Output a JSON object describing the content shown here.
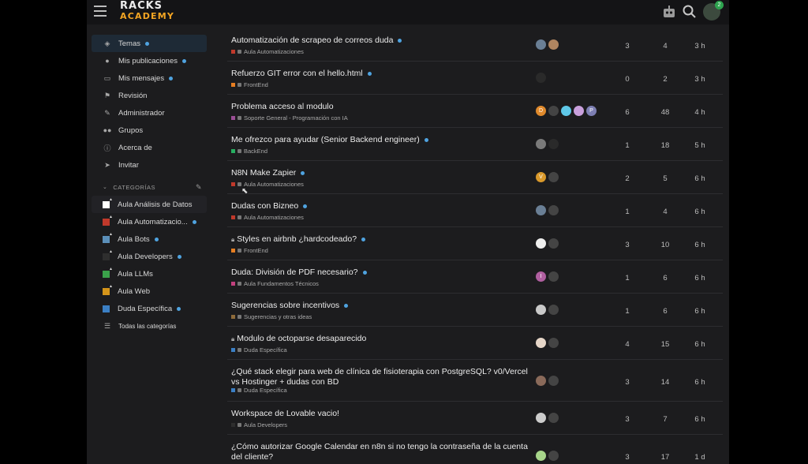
{
  "header": {
    "logo_top": "RACKS",
    "logo_bottom": "ACADEMY",
    "notification_count": "2"
  },
  "sidebar": {
    "items": [
      {
        "label": "Temas",
        "dot": true,
        "active": true
      },
      {
        "label": "Mis publicaciones",
        "dot": true
      },
      {
        "label": "Mis mensajes",
        "dot": true
      },
      {
        "label": "Revisión"
      },
      {
        "label": "Administrador"
      },
      {
        "label": "Grupos"
      },
      {
        "label": "Acerca de"
      },
      {
        "label": "Invitar"
      }
    ],
    "categories_heading": "CATEGORÍAS",
    "categories": [
      {
        "label": "Aula Análisis de Datos",
        "color": "#ffffff"
      },
      {
        "label": "Aula Automatizacio...",
        "color": "#c0392b",
        "dot": true
      },
      {
        "label": "Aula Bots",
        "color": "#5b8fb9",
        "dot": true
      },
      {
        "label": "Aula Developers",
        "color": "#2e2e2e",
        "dot": true
      },
      {
        "label": "Aula LLMs",
        "color": "#3aa24a"
      },
      {
        "label": "Aula Web",
        "color": "#d4941a"
      },
      {
        "label": "Duda Específica",
        "color": "#3b7fc4",
        "dot": true
      }
    ],
    "all_categories": "Todas las categorías"
  },
  "topics": [
    {
      "title": "Automatización de scrapeo de correos duda",
      "dot": true,
      "category": "Aula Automatizaciones",
      "cat_color": "#c0392b",
      "avatars": [
        "#6a7f95",
        "#b08560"
      ],
      "replies": "3",
      "views": "4",
      "activity": "3 h"
    },
    {
      "title": "Refuerzo GIT error con el hello.html",
      "dot": true,
      "category": "FrontEnd",
      "cat_color": "#e67e22",
      "avatars": [
        "#2a2a2a"
      ],
      "replies": "0",
      "views": "2",
      "activity": "3 h"
    },
    {
      "title": "Problema acceso al modulo",
      "category": "Soporte General - Programación con IA",
      "cat_color": "#9b4f96",
      "avatars": [
        "#e08a2c",
        "#444444",
        "#5fc8e8",
        "#c9a0dc",
        "#7d7fb3"
      ],
      "avatar_letters": [
        "D",
        "",
        "",
        "",
        "P"
      ],
      "replies": "6",
      "views": "48",
      "activity": "4 h"
    },
    {
      "title": "Me ofrezco para ayudar (Senior Backend engineer)",
      "dot": true,
      "category": "BackEnd",
      "cat_color": "#27ae60",
      "avatars": [
        "#7a7a7a",
        "#2a2a2a"
      ],
      "replies": "1",
      "views": "18",
      "activity": "5 h"
    },
    {
      "title": "N8N Make Zapier",
      "dot": true,
      "category": "Aula Automatizaciones",
      "cat_color": "#c0392b",
      "avatars": [
        "#d9992b",
        "#444444"
      ],
      "avatar_letters": [
        "V",
        ""
      ],
      "replies": "2",
      "views": "5",
      "activity": "6 h"
    },
    {
      "title": "Dudas con Bizneo",
      "dot": true,
      "category": "Aula Automatizaciones",
      "cat_color": "#c0392b",
      "avatars": [
        "#6a7f95",
        "#444444"
      ],
      "replies": "1",
      "views": "4",
      "activity": "6 h"
    },
    {
      "title": "Styles en airbnb ¿hardcodeado?",
      "dot": true,
      "locked": true,
      "category": "FrontEnd",
      "cat_color": "#e67e22",
      "avatars": [
        "#eeeeee",
        "#444444"
      ],
      "replies": "3",
      "views": "10",
      "activity": "6 h"
    },
    {
      "title": "Duda: División de PDF necesario?",
      "dot": true,
      "category": "Aula Fundamentos Técnicos",
      "cat_color": "#c2417e",
      "avatars": [
        "#b05fa0",
        "#444444"
      ],
      "avatar_letters": [
        "I",
        ""
      ],
      "replies": "1",
      "views": "6",
      "activity": "6 h"
    },
    {
      "title": "Sugerencias sobre incentivos",
      "dot": true,
      "category": "Sugerencias y otras ideas",
      "cat_color": "#8e6b3a",
      "avatars": [
        "#c9c9c9",
        "#444444"
      ],
      "replies": "1",
      "views": "6",
      "activity": "6 h"
    },
    {
      "title": "Modulo de octoparse desaparecido",
      "locked": true,
      "category": "Duda Específica",
      "cat_color": "#3b7fc4",
      "avatars": [
        "#e6d6c8",
        "#444444"
      ],
      "replies": "4",
      "views": "15",
      "activity": "6 h"
    },
    {
      "title": "¿Qué stack elegir para web de clínica de fisioterapia con PostgreSQL? v0/Vercel vs Hostinger + dudas con BD",
      "category": "Duda Específica",
      "cat_color": "#3b7fc4",
      "avatars": [
        "#8a6a5a",
        "#444444"
      ],
      "replies": "3",
      "views": "14",
      "activity": "6 h"
    },
    {
      "title": "Workspace de Lovable vacio!",
      "category": "Aula Developers",
      "cat_color": "#2e2e2e",
      "avatars": [
        "#cccccc",
        "#444444"
      ],
      "replies": "3",
      "views": "7",
      "activity": "6 h"
    },
    {
      "title": "¿Cómo autorizar Google Calendar en n8n si no tengo la contraseña de la cuenta del cliente?",
      "category": "",
      "cat_color": "#3b7fc4",
      "avatars": [
        "#a7d58a",
        "#444444"
      ],
      "replies": "3",
      "views": "17",
      "activity": "1 d"
    }
  ]
}
